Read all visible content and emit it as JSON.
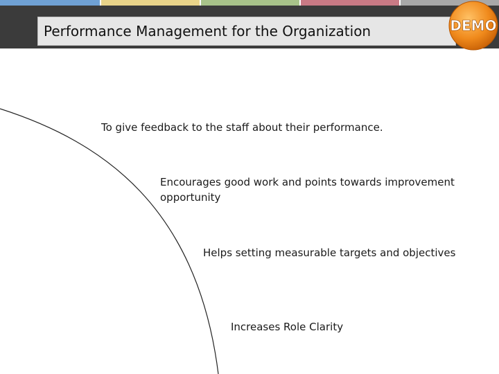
{
  "slide": {
    "title": "Performance Management for the Organization",
    "badge_text": "DEMO",
    "points": [
      "To give feedback to the staff about their performance.",
      "Encourages good work and points towards improvement opportunity",
      "Helps setting measurable targets and objectives",
      "Increases Role Clarity"
    ]
  },
  "colors": {
    "header_band": "#3b3b3b",
    "title_box": "#e6e6e6",
    "stripes": [
      "#6fa1d4",
      "#e9d48a",
      "#a8c38a",
      "#c97a85",
      "#a8a8a8"
    ],
    "badge": "#f08a1c"
  }
}
